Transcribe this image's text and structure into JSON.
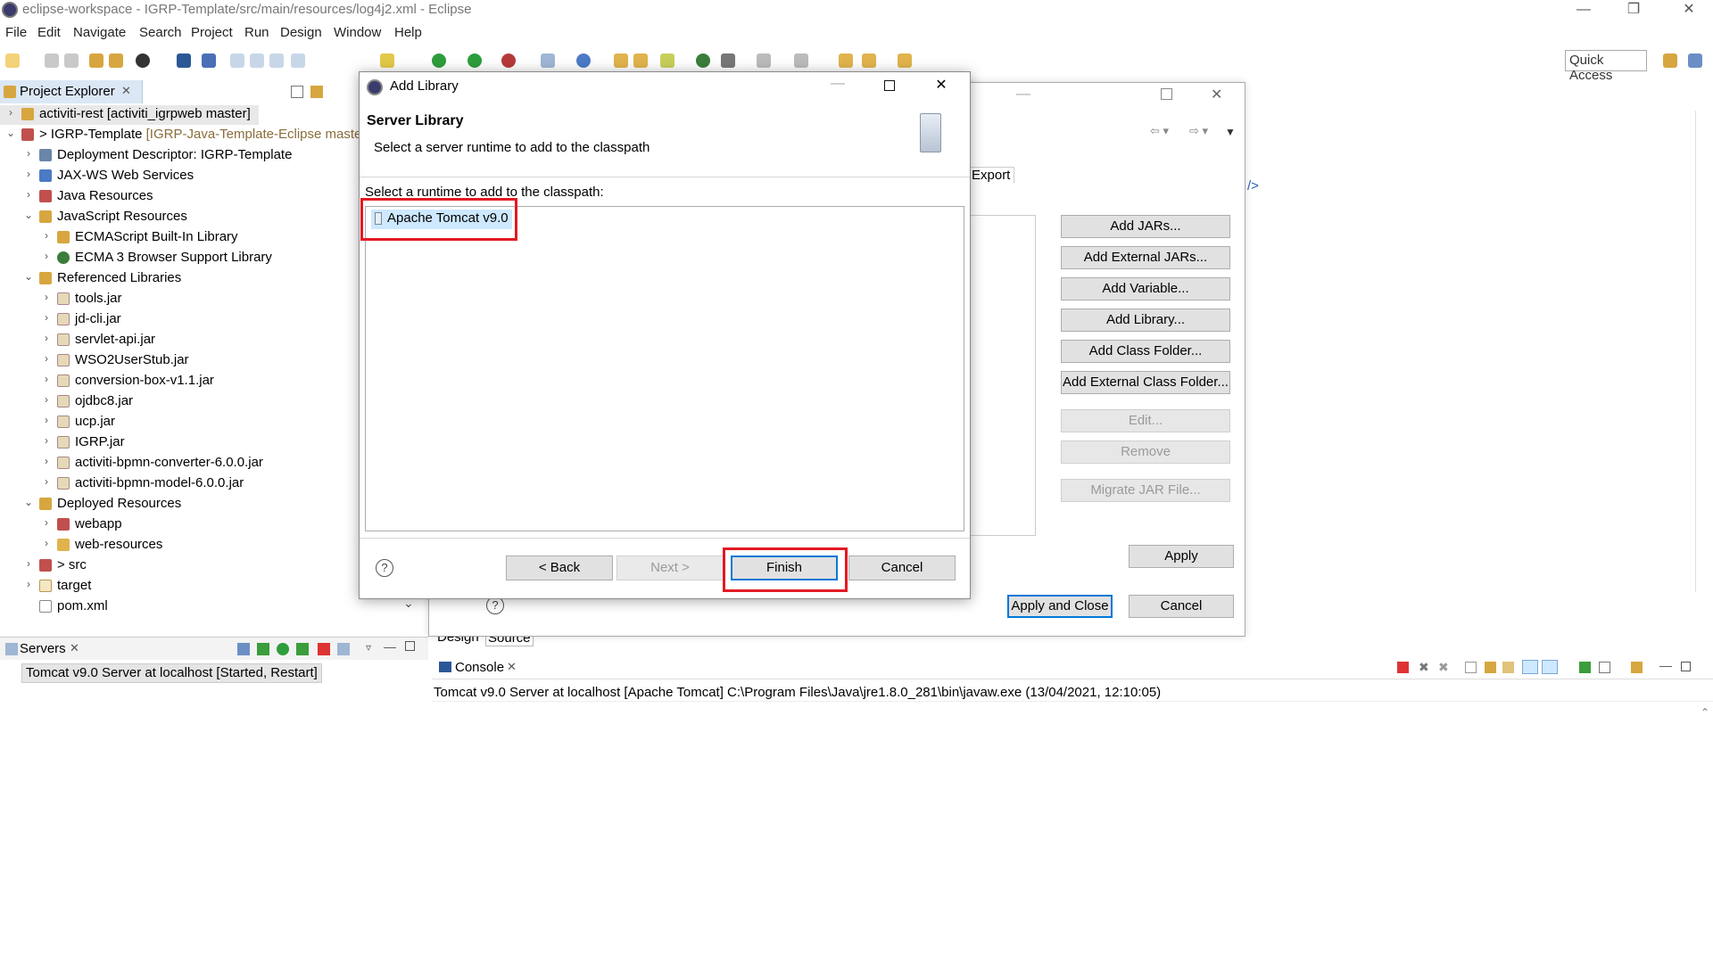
{
  "window": {
    "title": "eclipse-workspace - IGRP-Template/src/main/resources/log4j2.xml - Eclipse"
  },
  "menu": [
    "File",
    "Edit",
    "Navigate",
    "Search",
    "Project",
    "Run",
    "Design",
    "Window",
    "Help"
  ],
  "quick_access": "Quick Access",
  "project_explorer": {
    "title": "Project Explorer",
    "items": [
      {
        "label": "activiti-rest [activiti_igrpweb master]",
        "deco": ""
      },
      {
        "label": "> IGRP-Template",
        "deco": " [IGRP-Java-Template-Eclipse master"
      },
      {
        "label": "Deployment Descriptor: IGRP-Template",
        "deco": ""
      },
      {
        "label": "JAX-WS Web Services",
        "deco": ""
      },
      {
        "label": "Java Resources",
        "deco": ""
      },
      {
        "label": "JavaScript Resources",
        "deco": ""
      },
      {
        "label": "ECMAScript Built-In Library",
        "deco": ""
      },
      {
        "label": "ECMA 3 Browser Support Library",
        "deco": ""
      },
      {
        "label": "Referenced Libraries",
        "deco": ""
      },
      {
        "label": "tools.jar",
        "deco": ""
      },
      {
        "label": "jd-cli.jar",
        "deco": ""
      },
      {
        "label": "servlet-api.jar",
        "deco": ""
      },
      {
        "label": "WSO2UserStub.jar",
        "deco": ""
      },
      {
        "label": "conversion-box-v1.1.jar",
        "deco": ""
      },
      {
        "label": "ojdbc8.jar",
        "deco": ""
      },
      {
        "label": "ucp.jar",
        "deco": ""
      },
      {
        "label": "IGRP.jar",
        "deco": ""
      },
      {
        "label": "activiti-bpmn-converter-6.0.0.jar",
        "deco": ""
      },
      {
        "label": "activiti-bpmn-model-6.0.0.jar",
        "deco": ""
      },
      {
        "label": "Deployed Resources",
        "deco": ""
      },
      {
        "label": "webapp",
        "deco": ""
      },
      {
        "label": "web-resources",
        "deco": ""
      },
      {
        "label": "> src",
        "deco": ""
      },
      {
        "label": "target",
        "deco": ""
      },
      {
        "label": "pom.xml",
        "deco": ""
      }
    ]
  },
  "servers": {
    "title": "Servers",
    "row": "Tomcat v9.0 Server at localhost  [Started, Restart]"
  },
  "properties_dialog": {
    "tab_export": "Export",
    "buttons": [
      "Add JARs...",
      "Add External JARs...",
      "Add Variable...",
      "Add Library...",
      "Add Class Folder...",
      "Add External Class Folder..."
    ],
    "disabled_buttons": [
      "Edit...",
      "Remove",
      "Migrate JAR File..."
    ],
    "apply": "Apply",
    "apply_and_close": "Apply and Close",
    "cancel": "Cancel"
  },
  "editor": {
    "tail": "/>",
    "design_tab": "Design",
    "source_tab": "Source"
  },
  "console": {
    "title": "Console",
    "line": "Tomcat v9.0 Server at localhost [Apache Tomcat] C:\\Program Files\\Java\\jre1.8.0_281\\bin\\javaw.exe (13/04/2021, 12:10:05)"
  },
  "add_library": {
    "title": "Add Library",
    "banner_title": "Server Library",
    "banner_desc": "Select a server runtime to add to the classpath",
    "prompt": "Select a runtime to add to the classpath:",
    "runtime": "Apache Tomcat v9.0",
    "back": "< Back",
    "next": "Next >",
    "finish": "Finish",
    "cancel": "Cancel"
  },
  "colors": {
    "highlight": "#e21a23",
    "selection": "#cde8ff",
    "accent": "#0078d7"
  }
}
